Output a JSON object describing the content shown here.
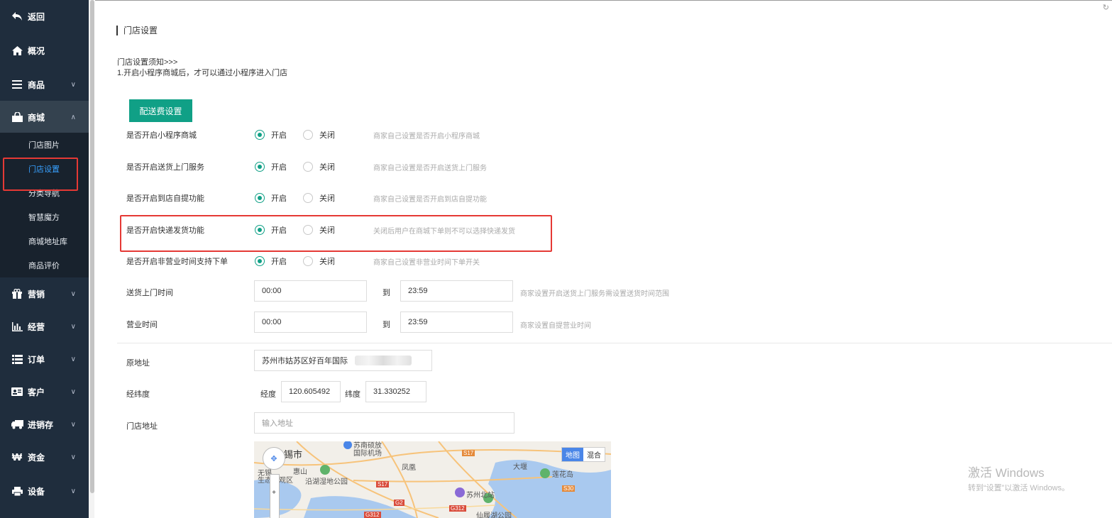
{
  "sidebar": {
    "items": [
      {
        "label": "返回",
        "icon": "back-arrow-icon"
      },
      {
        "label": "概况",
        "icon": "home-icon"
      },
      {
        "label": "商品",
        "icon": "menu-lines-icon"
      },
      {
        "label": "商城",
        "icon": "shopping-bag-icon"
      },
      {
        "label": "营销",
        "icon": "gift-icon"
      },
      {
        "label": "经营",
        "icon": "bar-chart-icon"
      },
      {
        "label": "订单",
        "icon": "list-icon"
      },
      {
        "label": "客户",
        "icon": "id-card-icon"
      },
      {
        "label": "进销存",
        "icon": "truck-icon"
      },
      {
        "label": "资金",
        "icon": "won-icon"
      },
      {
        "label": "设备",
        "icon": "printer-icon"
      }
    ],
    "submenu": [
      "门店图片",
      "门店设置",
      "分类导航",
      "智慧魔方",
      "商城地址库",
      "商品评价"
    ],
    "current_submenu": "门店设置"
  },
  "page": {
    "title": "门店设置",
    "notice_title": "门店设置须知>>>",
    "notice_line": "1.开启小程序商城后，才可以通过小程序进入门店",
    "delivery_fee_button": "配送费设置"
  },
  "settings": [
    {
      "label": "是否开启小程序商城",
      "on": "开启",
      "off": "关闭",
      "selected": "开启",
      "hint": "商家自己设置是否开启小程序商城"
    },
    {
      "label": "是否开启送货上门服务",
      "on": "开启",
      "off": "关闭",
      "selected": "开启",
      "hint": "商家自己设置是否开启送货上门服务"
    },
    {
      "label": "是否开启到店自提功能",
      "on": "开启",
      "off": "关闭",
      "selected": "开启",
      "hint": "商家自己设置是否开启到店自提功能"
    },
    {
      "label": "是否开启快递发货功能",
      "on": "开启",
      "off": "关闭",
      "selected": "开启",
      "hint": "关闭后用户在商城下单则不可以选择快递发货"
    },
    {
      "label": "是否开启非营业时间支持下单",
      "on": "开启",
      "off": "关闭",
      "selected": "开启",
      "hint": "商家自己设置非营业时间下单开关"
    }
  ],
  "delivery_time": {
    "label": "送货上门时间",
    "start": "00:00",
    "to": "到",
    "end": "23:59",
    "hint": "商家设置开启送货上门服务需设置送货时间范围"
  },
  "business_time": {
    "label": "营业时间",
    "start": "00:00",
    "to": "到",
    "end": "23:59",
    "hint": "商家设置自提营业时间"
  },
  "address": {
    "original_label": "原地址",
    "original_value": "苏州市姑苏区好百年国际",
    "latlng_label": "经纬度",
    "lng_label": "经度",
    "lng_value": "120.605492",
    "lat_label": "纬度",
    "lat_value": "31.330252",
    "store_label": "门店地址",
    "store_placeholder": "输入地址"
  },
  "map": {
    "type_map": "地图",
    "type_hybrid": "混合",
    "labels": [
      "锡市",
      "苏南硕放",
      "国际机场",
      "惠山",
      "无锡",
      "生态景观区",
      "沿湖湿地公园",
      "凤凰",
      "苏州北站",
      "大堰",
      "莲花岛",
      "仙履湖公园",
      "S17",
      "G2",
      "G312",
      "S17",
      "G312",
      "S30"
    ]
  },
  "watermark": {
    "title": "激活 Windows",
    "subtitle": "转到“设置”以激活 Windows。"
  }
}
